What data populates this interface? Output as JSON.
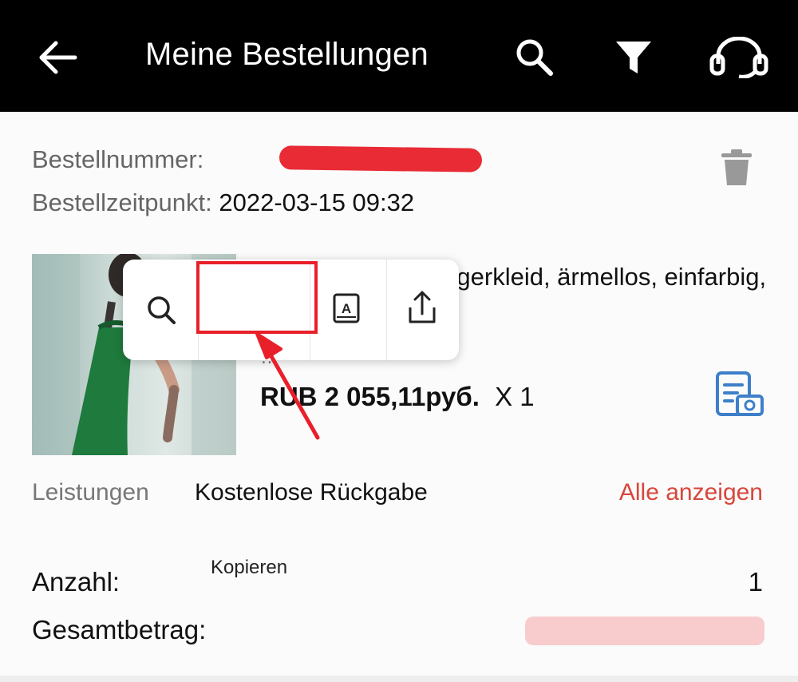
{
  "header": {
    "title": "Meine Bestellungen",
    "icons": [
      "back-arrow-icon",
      "search-icon",
      "filter-icon",
      "headset-icon"
    ],
    "background": "#000000"
  },
  "order": {
    "number_label": "Bestellnummer:",
    "number_value": "",
    "time_label": "Bestellzeitpunkt:",
    "time_value": "2022-03-15 09:32"
  },
  "product": {
    "title": "Damen Satin-Hängerkleid, ärmellos, einfarbig, figurbe’sexy...",
    "price": "RUB 2 055,11руб.",
    "quantity": "X 1"
  },
  "context_menu": {
    "copy_label": "Kopieren",
    "icons": [
      "search-icon",
      "lookup-icon",
      "share-icon"
    ]
  },
  "services": {
    "label": "Leistungen",
    "value": "Kostenlose Rückgabe",
    "link": "Alle anzeigen"
  },
  "summary": {
    "quantity_label": "Anzahl:",
    "quantity_value": "1",
    "total_label": "Gesamtbetrag:",
    "total_value": ""
  },
  "colors": {
    "accent_link": "#d9463b",
    "annotation_red": "#e8202a",
    "icon_blue": "#3e7fc9"
  }
}
